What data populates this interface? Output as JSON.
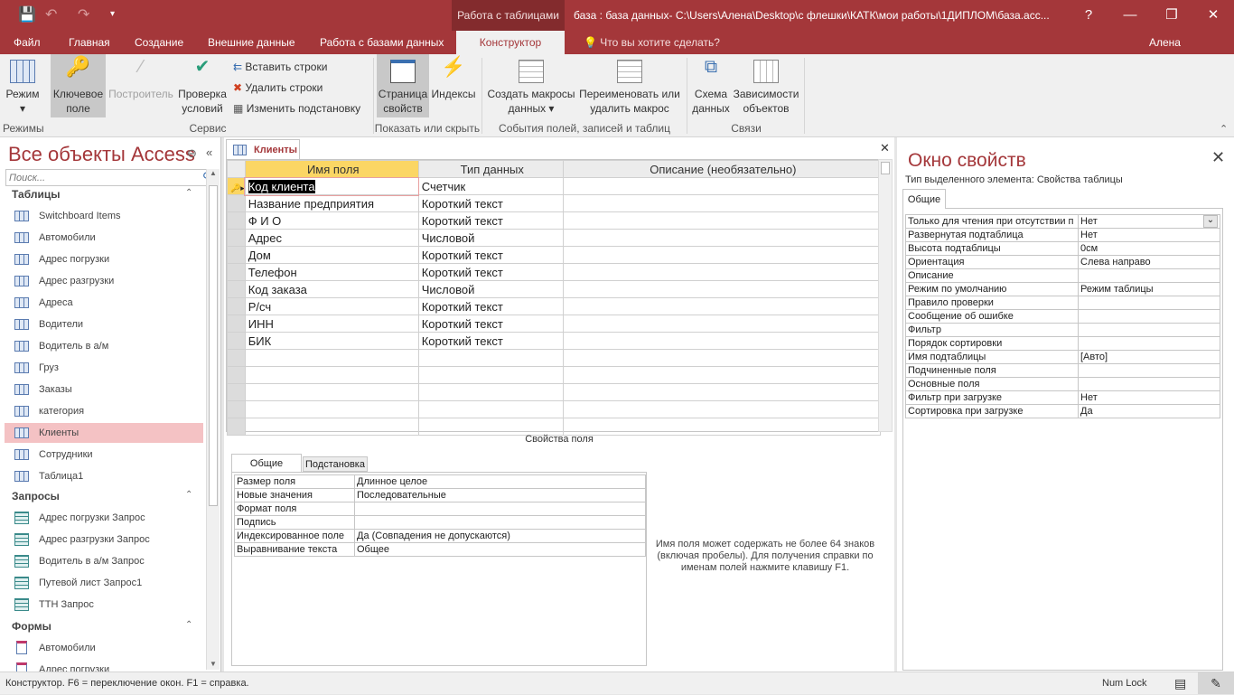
{
  "titlebar": {
    "context_tab": "Работа с таблицами",
    "title": "база : база данных- C:\\Users\\Алена\\Desktop\\с флешки\\КАТК\\мои работы\\1ДИПЛОМ\\база.acc...",
    "help": "?",
    "minimize": "—",
    "restore": "❐",
    "close": "✕",
    "user": "Алена Иванова",
    "tell_me": "Что вы хотите сделать?"
  },
  "ribbon_tabs": [
    "Файл",
    "Главная",
    "Создание",
    "Внешние данные",
    "Работа с базами данных",
    "Конструктор"
  ],
  "ribbon": {
    "mode": "Режим",
    "key_field": "Ключевое поле",
    "builder": "Построитель",
    "test_rules": "Проверка условий",
    "insert_rows": "Вставить строки",
    "delete_rows": "Удалить строки",
    "modify_lookup": "Изменить подстановку",
    "property_sheet": "Страница свойств",
    "indexes": "Индексы",
    "create_macros": "Создать макросы данных",
    "rename_macro": "Переименовать или удалить макрос",
    "relationships": "Схема данных",
    "dependencies": "Зависимости объектов",
    "groups": [
      "Режимы",
      "Сервис",
      "Показать или скрыть",
      "События полей, записей и таблиц",
      "Связи"
    ]
  },
  "nav": {
    "title": "Все объекты Access",
    "search_placeholder": "Поиск...",
    "sections": [
      {
        "label": "Таблицы",
        "type": "table",
        "items": [
          "Switchboard Items",
          "Автомобили",
          "Адрес погрузки",
          "Адрес разгрузки",
          "Адреса",
          "Водители",
          "Водитель в а/м",
          "Груз",
          "Заказы",
          "категория",
          "Клиенты",
          "Сотрудники",
          "Таблица1"
        ]
      },
      {
        "label": "Запросы",
        "type": "query",
        "items": [
          "Адрес погрузки Запрос",
          "Адрес разгрузки Запрос",
          "Водитель в а/м Запрос",
          "Путевой лист Запрос1",
          "ТТН Запрос"
        ]
      },
      {
        "label": "Формы",
        "type": "form",
        "items": [
          "Автомобили",
          "Адрес погрузки"
        ]
      }
    ],
    "selected": "Клиенты"
  },
  "document": {
    "tab": "Клиенты",
    "columns": [
      "Имя поля",
      "Тип данных",
      "Описание (необязательно)"
    ],
    "rows": [
      [
        "Код клиента",
        "Счетчик",
        ""
      ],
      [
        "Название предприятия",
        "Короткий текст",
        ""
      ],
      [
        "Ф И О",
        "Короткий текст",
        ""
      ],
      [
        "Адрес",
        "Числовой",
        ""
      ],
      [
        "Дом",
        "Короткий текст",
        ""
      ],
      [
        "Телефон",
        "Короткий текст",
        ""
      ],
      [
        "Код заказа",
        "Числовой",
        ""
      ],
      [
        "Р/сч",
        "Короткий текст",
        ""
      ],
      [
        "ИНН",
        "Короткий текст",
        ""
      ],
      [
        "БИК",
        "Короткий текст",
        ""
      ]
    ],
    "field_props_caption": "Свойства поля",
    "field_tabs": [
      "Общие",
      "Подстановка"
    ],
    "field_props": [
      [
        "Размер поля",
        "Длинное целое"
      ],
      [
        "Новые значения",
        "Последовательные"
      ],
      [
        "Формат поля",
        ""
      ],
      [
        "Подпись",
        ""
      ],
      [
        "Индексированное поле",
        "Да (Совпадения не допускаются)"
      ],
      [
        "Выравнивание текста",
        "Общее"
      ]
    ],
    "help_text": "Имя поля может содержать не более 64 знаков (включая пробелы). Для получения справки по именам полей нажмите клавишу F1."
  },
  "property_sheet": {
    "title": "Окно свойств",
    "selection_type": "Тип выделенного элемента:  Свойства таблицы",
    "tab": "Общие",
    "rows": [
      [
        "Только для чтения при отсутствии п",
        "Нет"
      ],
      [
        "Развернутая подтаблица",
        "Нет"
      ],
      [
        "Высота подтаблицы",
        "0см"
      ],
      [
        "Ориентация",
        "Слева направо"
      ],
      [
        "Описание",
        ""
      ],
      [
        "Режим по умолчанию",
        "Режим таблицы"
      ],
      [
        "Правило проверки",
        ""
      ],
      [
        "Сообщение об ошибке",
        ""
      ],
      [
        "Фильтр",
        ""
      ],
      [
        "Порядок сортировки",
        ""
      ],
      [
        "Имя подтаблицы",
        "[Авто]"
      ],
      [
        "Подчиненные поля",
        ""
      ],
      [
        "Основные поля",
        ""
      ],
      [
        "Фильтр при загрузке",
        "Нет"
      ],
      [
        "Сортировка при загрузке",
        "Да"
      ]
    ]
  },
  "status": {
    "text": "Конструктор.  F6 = переключение окон.  F1 = справка.",
    "numlock": "Num Lock"
  },
  "colors": {
    "accent": "#a4373a",
    "context": "#832b2d",
    "selected_nav": "#f4c2c4",
    "header_current": "#fbd664"
  }
}
